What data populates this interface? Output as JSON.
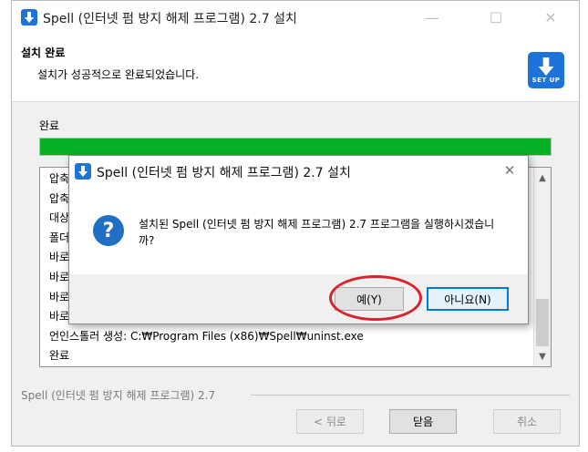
{
  "installer": {
    "title": "Spell (인터넷 펌 방지 해제 프로그램) 2.7 설치",
    "header_title": "설치 완료",
    "header_subtitle": "설치가 성공적으로 완료되었습니다.",
    "logo_text": "SET UP",
    "status_label": "완료",
    "progress_percent": 100,
    "log_lines": [
      "압축",
      "압축",
      "대상",
      "폴더",
      "바로",
      "바로",
      "바로",
      "바로",
      "언인스톨러 생성: C:₩Program Files (x86)₩Spell₩uninst.exe",
      "완료"
    ],
    "branding": "Spell (인터넷 펌 방지 해제 프로그램) 2.7",
    "buttons": {
      "back": "< 뒤로",
      "close": "닫음",
      "cancel": "취소"
    }
  },
  "dialog": {
    "title": "Spell (인터넷 펌 방지 해제 프로그램) 2.7 설치",
    "message": "설치된 Spell (인터넷 펌 방지 해제 프로그램) 2.7 프로그램을 실행하시겠습니까?",
    "yes_label": "예(Y)",
    "no_label": "아니요(N)"
  },
  "icons": {
    "app": "download-arrow-icon",
    "question": "question-icon",
    "close": "close-icon"
  },
  "colors": {
    "accent": "#1e73d8",
    "progress": "#06b025",
    "highlight": "#d9232c",
    "default_button_border": "#0078d7"
  }
}
